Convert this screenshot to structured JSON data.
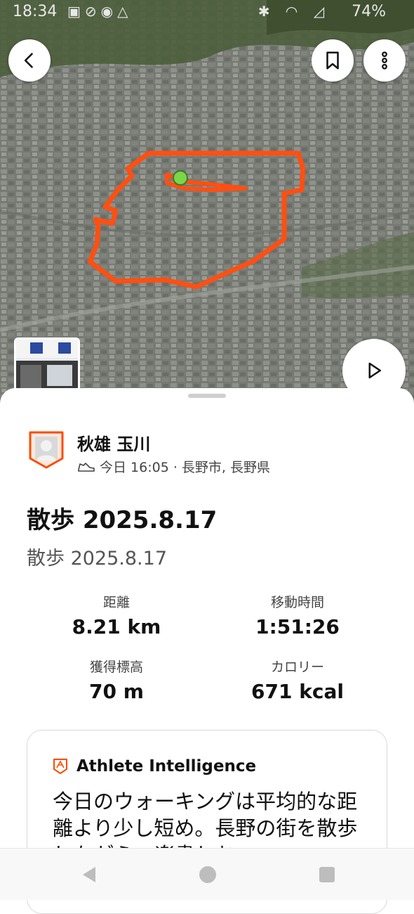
{
  "status_bar": {
    "time": "18:34",
    "battery": "74%"
  },
  "map": {
    "route_color": "#ff4f12",
    "start_marker_color": "#7bd64a"
  },
  "icons": {
    "back": "chevron-left-icon",
    "bookmark": "bookmark-icon",
    "more": "more-vertical-icon",
    "play": "play-icon",
    "activity_type": "shoe-icon",
    "ai": "athlete-intelligence-icon"
  },
  "athlete": {
    "name": "秋雄 玉川",
    "meta": "今日 16:05 · 長野市, 長野県"
  },
  "activity": {
    "title": "散歩 2025.8.17",
    "subtitle": "散歩 2025.8.17"
  },
  "stats": {
    "distance_label": "距離",
    "distance_value": "8.21 km",
    "moving_time_label": "移動時間",
    "moving_time_value": "1:51:26",
    "elevation_label": "獲得標高",
    "elevation_value": "70 m",
    "calories_label": "カロリー",
    "calories_value": "671 kcal"
  },
  "athlete_intelligence": {
    "header": "Athlete Intelligence",
    "text": "今日のウォーキングは平均的な距離より少し短め。長野の街を散歩しながら、楽書しむ"
  },
  "colors": {
    "accent": "#fc4c02",
    "text_primary": "#111111",
    "text_secondary": "#555555"
  }
}
